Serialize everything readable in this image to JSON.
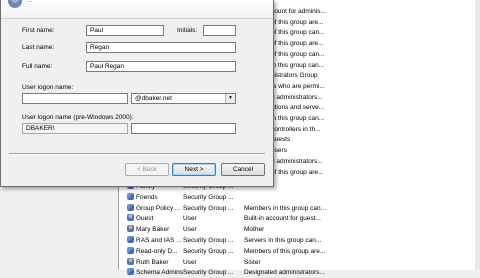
{
  "dialog": {
    "title": "...",
    "labels": {
      "first_name": "First name:",
      "initials": "Initials:",
      "last_name": "Last name:",
      "full_name": "Full name:",
      "logon_name": "User logon name:",
      "logon_name_pre2000": "User logon name (pre-Windows 2000):"
    },
    "values": {
      "first_name": "Paul",
      "initials": "",
      "last_name": "Regan",
      "full_name": "Paul Regan",
      "logon_name": "",
      "domain_suffix": "@dbaker.net",
      "pre2000_domain": "DBAKER\\",
      "pre2000_name": ""
    },
    "buttons": {
      "back": "< Back",
      "next": "Next >",
      "cancel": "Cancel"
    }
  },
  "background_list": {
    "partial_rows": [
      "count for adminis...",
      "of this group are...",
      "of this group can...",
      "of this group are...",
      "of this group can...",
      "in this group can...",
      "nistrators Group",
      "rs who are permi...",
      "d administrators...",
      "ations and serve...",
      "in this group can...",
      "controllers in th...",
      "guests",
      "users",
      "d administrators...",
      "of this group are..."
    ],
    "rows": [
      {
        "icon": "group",
        "name": "Family",
        "type": "Security Group ...",
        "desc": ""
      },
      {
        "icon": "group",
        "name": "Friends",
        "type": "Security Group ...",
        "desc": ""
      },
      {
        "icon": "group",
        "name": "Group Policy ...",
        "type": "Security Group ...",
        "desc": "Members in this group can..."
      },
      {
        "icon": "user",
        "name": "Guest",
        "type": "User",
        "desc": "Built-in account for guest..."
      },
      {
        "icon": "user",
        "name": "Mary Baker",
        "type": "User",
        "desc": "Mother"
      },
      {
        "icon": "group",
        "name": "RAS and IAS ...",
        "type": "Security Group ...",
        "desc": "Servers in this group can..."
      },
      {
        "icon": "group",
        "name": "Read-only D...",
        "type": "Security Group ...",
        "desc": "Members of this group are..."
      },
      {
        "icon": "user",
        "name": "Ruth Baker",
        "type": "User",
        "desc": "Sister"
      },
      {
        "icon": "group",
        "name": "Schema Admins",
        "type": "Security Group ...",
        "desc": "Designated administrators..."
      }
    ]
  }
}
